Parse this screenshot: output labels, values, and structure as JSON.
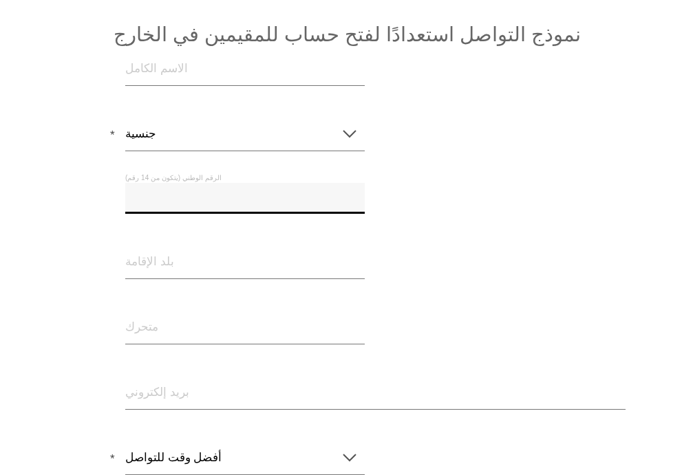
{
  "title": "نموذج التواصل استعدادًا لفتح حساب للمقيمين في الخارج",
  "fields": [
    {
      "kind": "text",
      "placeholder": "الاسم الكامل",
      "wide": false
    },
    {
      "kind": "select",
      "value": "جنسية",
      "required_mark": "*",
      "wide": false
    },
    {
      "kind": "text",
      "label": "الرقم الوطني (يتكون من 14 رقم)",
      "focused": true,
      "wide": false
    },
    {
      "kind": "text",
      "placeholder": "بلد الإقامة",
      "wide": false
    },
    {
      "kind": "text",
      "placeholder": "متحرك",
      "wide": false
    },
    {
      "kind": "text",
      "placeholder": "بريد إلكتروني",
      "wide": true
    },
    {
      "kind": "select",
      "value": "أفضل وقت للتواصل",
      "required_mark": "*",
      "wide": false
    }
  ]
}
